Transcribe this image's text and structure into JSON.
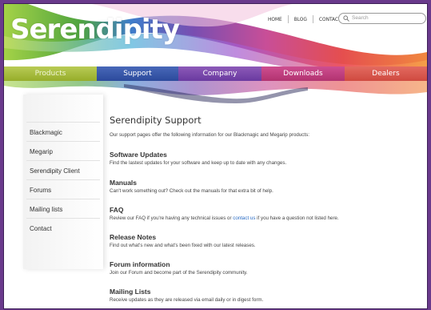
{
  "brand": {
    "logo": "Serendipity"
  },
  "topnav": [
    "HOME",
    "BLOG",
    "CONTACT"
  ],
  "search": {
    "placeholder": "Search"
  },
  "menu": [
    "Products",
    "Support",
    "Company",
    "Downloads",
    "Dealers"
  ],
  "sidebar": [
    "Blackmagic",
    "Megarip",
    "Serendipity Client",
    "Forums",
    "Mailing lists",
    "Contact"
  ],
  "content": {
    "title": "Serendipity Support",
    "intro": "Our support pages offer the following information for our Blackmagic and Megarip products:",
    "sections": [
      {
        "title": "Software Updates",
        "desc": "Find the lastest updates for your software and keep up to date with any changes."
      },
      {
        "title": "Manuals",
        "desc": "Can't work something out? Check out the manuals for that extra bit of help."
      },
      {
        "title": "FAQ",
        "desc_pre": "Review our FAQ if you're having any technical issues or ",
        "link": "contact us",
        "desc_post": " if you have a question not listed here."
      },
      {
        "title": "Release Notes",
        "desc": "Find out what's new and what's been fixed with our latest releases."
      },
      {
        "title": "Forum information",
        "desc": "Join our Forum and become part of the Serendipity community."
      },
      {
        "title": "Mailing Lists",
        "desc": "Receive updates as they are released via email daily or in digest form."
      }
    ]
  },
  "colors": {
    "products": "#a9bf3f",
    "support": "#3a5aab",
    "company": "#7c4aaf",
    "downloads": "#c0407f",
    "dealers": "#d9584f",
    "link": "#2b6cc4"
  }
}
